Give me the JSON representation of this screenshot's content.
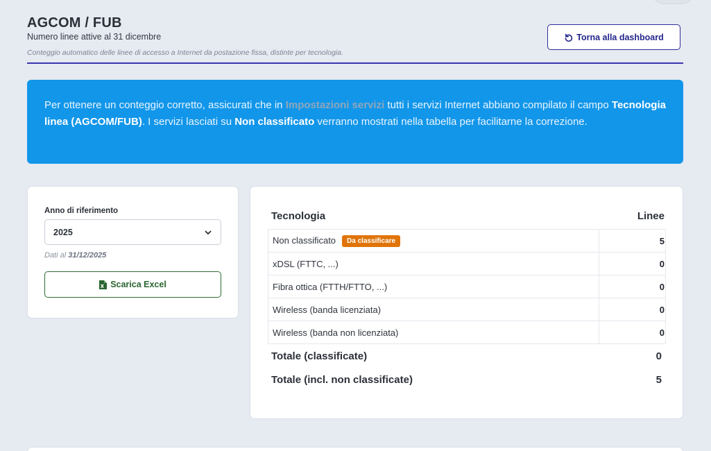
{
  "header": {
    "title": "AGCOM / FUB",
    "subtitle": "Numero linee attive al 31 dicembre",
    "description": "Conteggio automatico delle linee di accesso a Internet da postazione fissa, distinte per tecnologia.",
    "back_button_label": "Torna alla dashboard",
    "back_icon": "undo-arrow-icon"
  },
  "info_banner": {
    "part1": "Per ottenere un conteggio corretto, assicurati che in ",
    "link": "Impostazioni servizi",
    "part2": " tutti i servizi Internet abbiano compilato il campo ",
    "bold1": "Tecnologia linea (AGCOM/FUB)",
    "part3": ". I servizi lasciati su ",
    "bold2": "Non classificato",
    "part4": " verranno mostrati nella tabella per facilitarne la correzione."
  },
  "filters": {
    "year_label": "Anno di riferimento",
    "year_selected": "2025",
    "dati_prefix": "Dati al",
    "dati_date": "31/12/2025",
    "excel_button_label": "Scarica Excel",
    "excel_icon": "excel-file-icon"
  },
  "table": {
    "col_tech": "Tecnologia",
    "col_lines": "Linee",
    "rows": [
      {
        "tech": "Non classificato",
        "badge": "Da classificare",
        "lines": "5"
      },
      {
        "tech": "xDSL (FTTC, ...)",
        "lines": "0"
      },
      {
        "tech": "Fibra ottica (FTTH/FTTO, ...)",
        "lines": "0"
      },
      {
        "tech": "Wireless (banda licenziata)",
        "lines": "0"
      },
      {
        "tech": "Wireless (banda non licenziata)",
        "lines": "0"
      }
    ],
    "total_classified_label": "Totale (classificate)",
    "total_classified_value": "0",
    "total_all_label": "Totale (incl. non classificate)",
    "total_all_value": "5"
  },
  "colors": {
    "accent": "#2c2d9a",
    "banner": "#1296ea",
    "badge": "#e07408",
    "excel": "#2f6b35"
  }
}
